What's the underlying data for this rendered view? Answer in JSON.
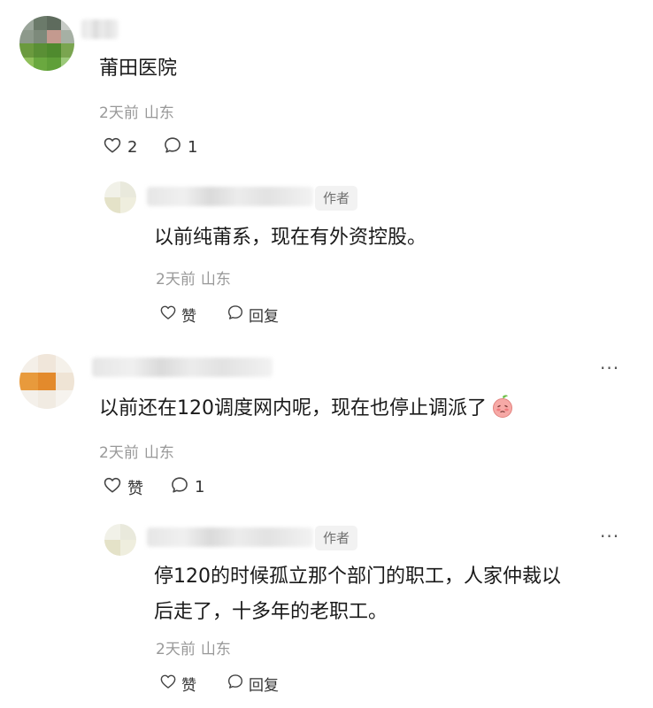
{
  "comments": [
    {
      "text": "莆田医院",
      "time": "2天前",
      "location": "山东",
      "like_count": "2",
      "reply_count": "1",
      "reply": {
        "author_badge": "作者",
        "text": "以前纯莆系，现在有外资控股。",
        "time": "2天前",
        "location": "山东",
        "like_label": "赞",
        "reply_label": "回复"
      }
    },
    {
      "text": "以前还在120调度网内呢，现在也停止调派了",
      "emoji": "peach-blush-emoji",
      "time": "2天前",
      "location": "山东",
      "like_label": "赞",
      "reply_count": "1",
      "more_label": "···",
      "reply": {
        "author_badge": "作者",
        "text_line1": "停120的时候孤立那个部门的职工，人家仲裁以",
        "text_line2": "后走了，十多年的老职工。",
        "time": "2天前",
        "location": "山东",
        "like_label": "赞",
        "reply_label": "回复",
        "more_label": "···"
      }
    }
  ],
  "icons": {
    "like": "heart-outline-icon",
    "reply": "speech-bubble-icon",
    "more": "more-dots-icon"
  },
  "colors": {
    "text": "#1a1a1a",
    "meta": "#999999",
    "badge_bg": "#f2f2f2",
    "badge_text": "#707070"
  }
}
